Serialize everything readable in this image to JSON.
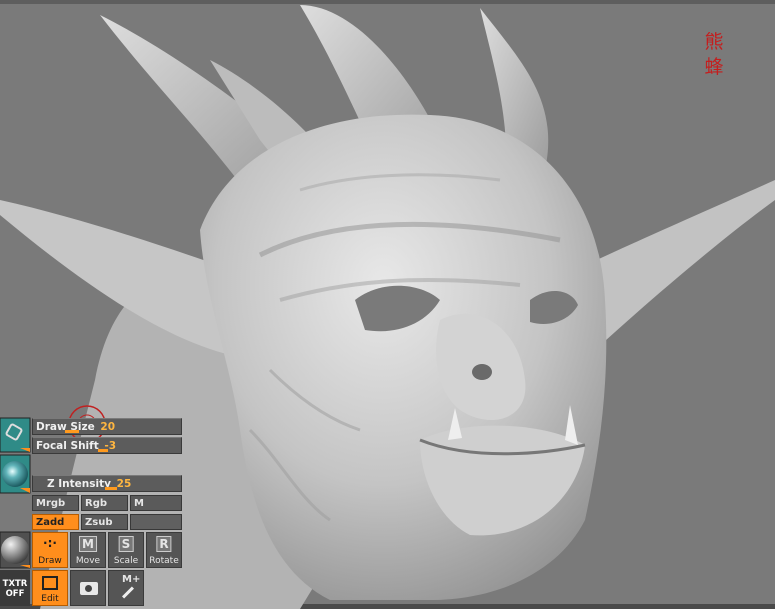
{
  "viewport": {
    "background": "#7a7a7a",
    "model_color": "#c9c9c9",
    "subject": "sculpted-demon-head"
  },
  "seal": {
    "chars": [
      "熊",
      "蜂"
    ],
    "color": "#c41e1e"
  },
  "panel": {
    "draw_size": {
      "label": "Draw Size",
      "value": "20",
      "level": 0.2
    },
    "focal_shift": {
      "label": "Focal Shift",
      "value": "-3",
      "level": 0.05
    },
    "z_intensity": {
      "label": "Z Intensity",
      "value": "25",
      "level": 0.25
    },
    "color_modes": {
      "mrgb": "Mrgb",
      "rgb": "Rgb",
      "m": "M"
    },
    "z_modes": {
      "zadd": "Zadd",
      "zsub": "Zsub"
    },
    "tools": {
      "draw": "Draw",
      "move": {
        "key": "M",
        "label": "Move"
      },
      "scale": {
        "key": "S",
        "label": "Scale"
      },
      "rotate": {
        "key": "R",
        "label": "Rotate"
      }
    },
    "texture": {
      "line1": "TXTR",
      "line2": "OFF"
    },
    "edit": "Edit",
    "snapshot_icon": "camera-icon",
    "mplus": "M+"
  },
  "accent_color": "#ff8e1c"
}
